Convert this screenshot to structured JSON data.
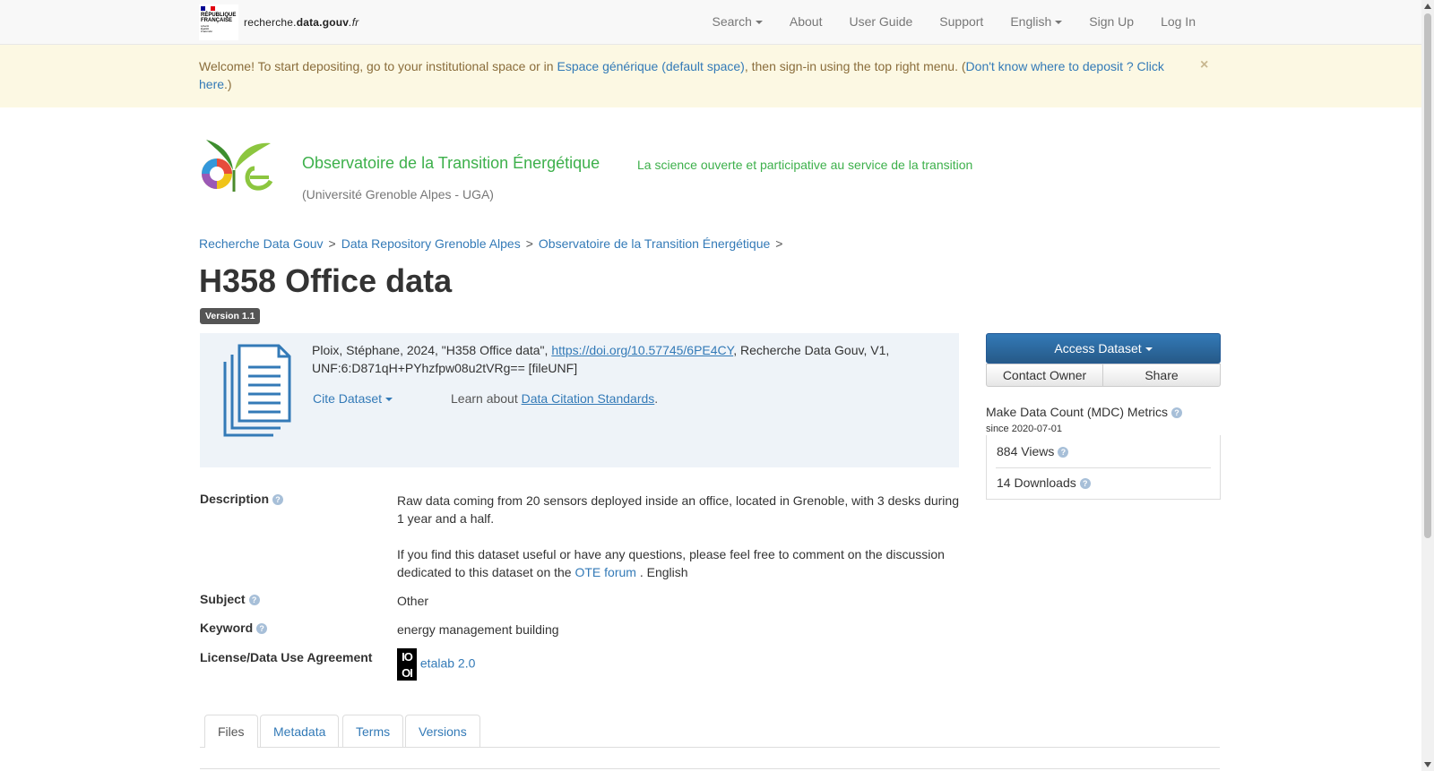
{
  "brand": {
    "republic_lines": [
      "RÉPUBLIQUE",
      "FRANÇAISE"
    ],
    "motto_lines": [
      "Liberté",
      "Égalité",
      "Fraternité"
    ],
    "site_prefix": "recherche.",
    "site_bold": "data.gouv",
    "site_suffix": ".fr"
  },
  "nav": {
    "search": "Search",
    "about": "About",
    "user_guide": "User Guide",
    "support": "Support",
    "language": "English",
    "sign_up": "Sign Up",
    "log_in": "Log In"
  },
  "alert": {
    "text_1": "Welcome! To start depositing, go to your institutional space or in ",
    "link_1": "Espace générique (default space)",
    "text_2": ", then sign-in using the top right menu. (",
    "link_2": "Don't know where to deposit ? Click here",
    "text_3": ".)",
    "close": "×"
  },
  "dataverse": {
    "name": "Observatoire de la Transition Énergétique",
    "tagline": "La science ouverte et participative au service de la transition",
    "affiliation": "(Université Grenoble Alpes - UGA)"
  },
  "breadcrumb": [
    "Recherche Data Gouv",
    "Data Repository Grenoble Alpes",
    "Observatoire de la Transition Énergétique"
  ],
  "breadcrumb_sep": ">",
  "dataset": {
    "title": "H358 Office data",
    "version": "Version 1.1"
  },
  "citation": {
    "text_1": "Ploix, Stéphane, 2024, \"H358 Office data\", ",
    "doi": "https://doi.org/10.57745/6PE4CY",
    "text_2": ", Recherche Data Gouv, V1, UNF:6:D871qH+PYhzfpw08u2tVRg== [fileUNF]",
    "cite_button": "Cite Dataset",
    "learn_prefix": "Learn about ",
    "learn_link": "Data Citation Standards",
    "learn_suffix": "."
  },
  "sidebar": {
    "access": "Access Dataset",
    "contact": "Contact Owner",
    "share": "Share",
    "mdc_title": "Make Data Count (MDC) Metrics",
    "mdc_since": "since 2020-07-01",
    "views": "884 Views",
    "downloads": "14 Downloads"
  },
  "metadata": {
    "description_label": "Description",
    "description_1": "Raw data coming from 20 sensors deployed inside an office, located in Grenoble, with 3 desks during 1 year and a half.",
    "description_2a": "If you find this dataset useful or have any questions, please feel free to comment on the discussion dedicated to this dataset on the ",
    "description_link": "OTE forum",
    "description_2b": " . English",
    "subject_label": "Subject",
    "subject_value": "Other",
    "keyword_label": "Keyword",
    "keyword_value": "energy management building",
    "license_label": "License/Data Use Agreement",
    "license_value": "etalab 2.0",
    "license_icon_top": "IO",
    "license_icon_bottom": "OI"
  },
  "tabs": [
    "Files",
    "Metadata",
    "Terms",
    "Versions"
  ],
  "colors": {
    "link": "#337ab7",
    "ote_green": "#3db04b",
    "alert_bg": "#fcf8e3",
    "primary": "#2c6cb1"
  }
}
